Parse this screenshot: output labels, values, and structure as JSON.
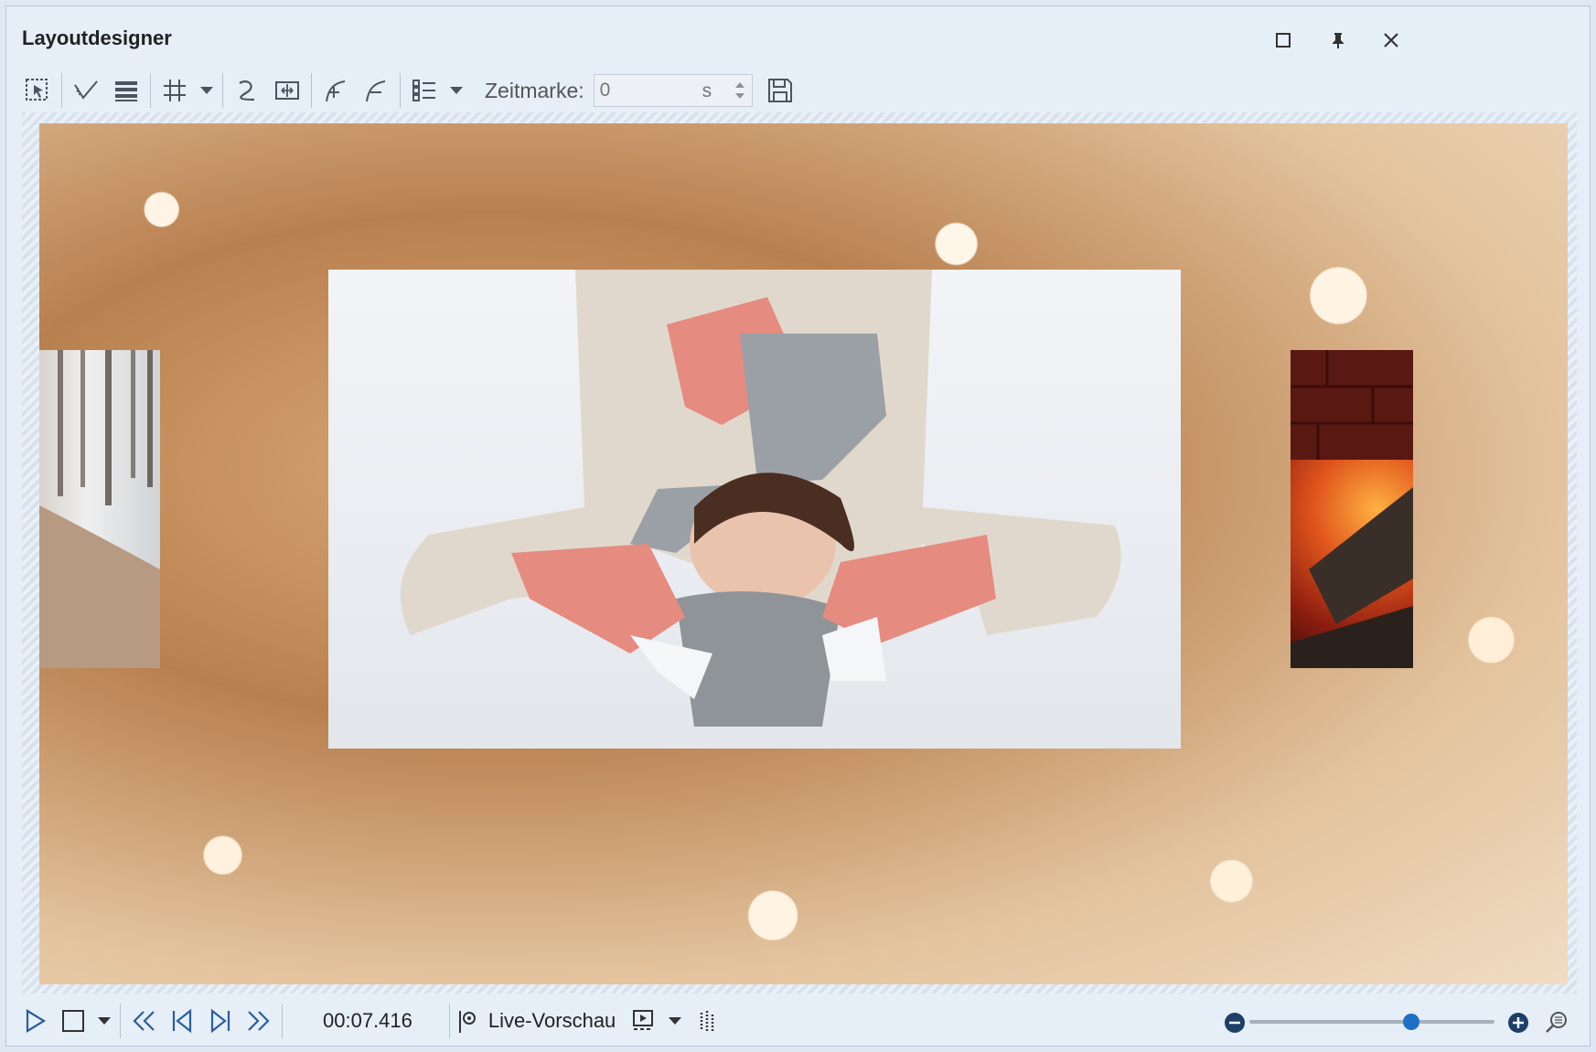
{
  "window": {
    "title": "Layoutdesigner"
  },
  "toolbar": {
    "zeitmarke_label": "Zeitmarke:",
    "zeitmarke_value": "0",
    "zeitmarke_unit": "s"
  },
  "stage": {
    "background": "glitter-bokeh-background",
    "images": [
      {
        "name": "woman-lying-in-snow"
      },
      {
        "name": "person-in-snowy-forest"
      },
      {
        "name": "fireplace-logs"
      }
    ]
  },
  "statusbar": {
    "timecode": "00:07.416",
    "live_preview_label": "Live-Vorschau",
    "zoom_level_fraction": 0.66
  },
  "colors": {
    "accent": "#1e6fc7",
    "icon": "#4a5560"
  }
}
